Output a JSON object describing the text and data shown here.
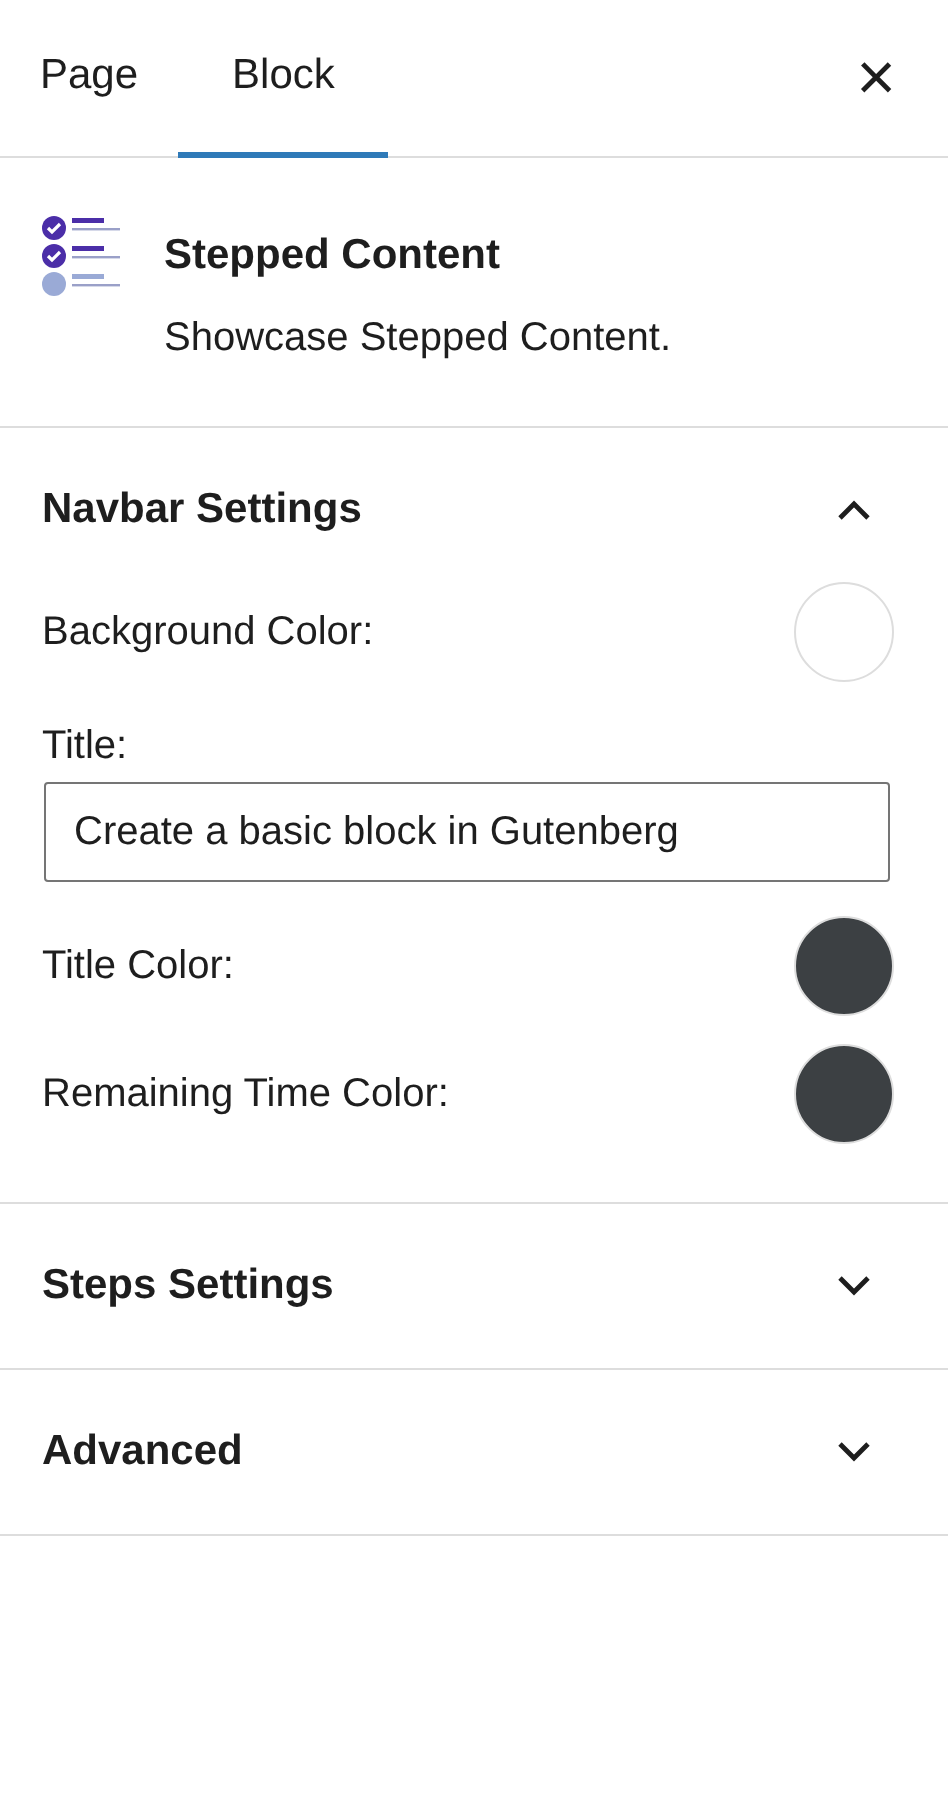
{
  "tabs": [
    {
      "label": "Page",
      "selected": false
    },
    {
      "label": "Block",
      "selected": true
    }
  ],
  "close": "×",
  "block": {
    "title": "Stepped Content",
    "description": "Showcase Stepped Content."
  },
  "panels": [
    {
      "title": "Navbar Settings",
      "expanded": true,
      "fields": [
        {
          "kind": "color",
          "label": "Background Color:",
          "color": "#ffffff"
        },
        {
          "kind": "text",
          "label": "Title:",
          "value": "Create a basic block in Gutenberg"
        },
        {
          "kind": "color",
          "label": "Title Color:",
          "color": "#3c4043"
        },
        {
          "kind": "color",
          "label": "Remaining Time Color:",
          "color": "#3c4043"
        }
      ]
    },
    {
      "title": "Steps Settings",
      "expanded": false
    },
    {
      "title": "Advanced",
      "expanded": false
    }
  ]
}
